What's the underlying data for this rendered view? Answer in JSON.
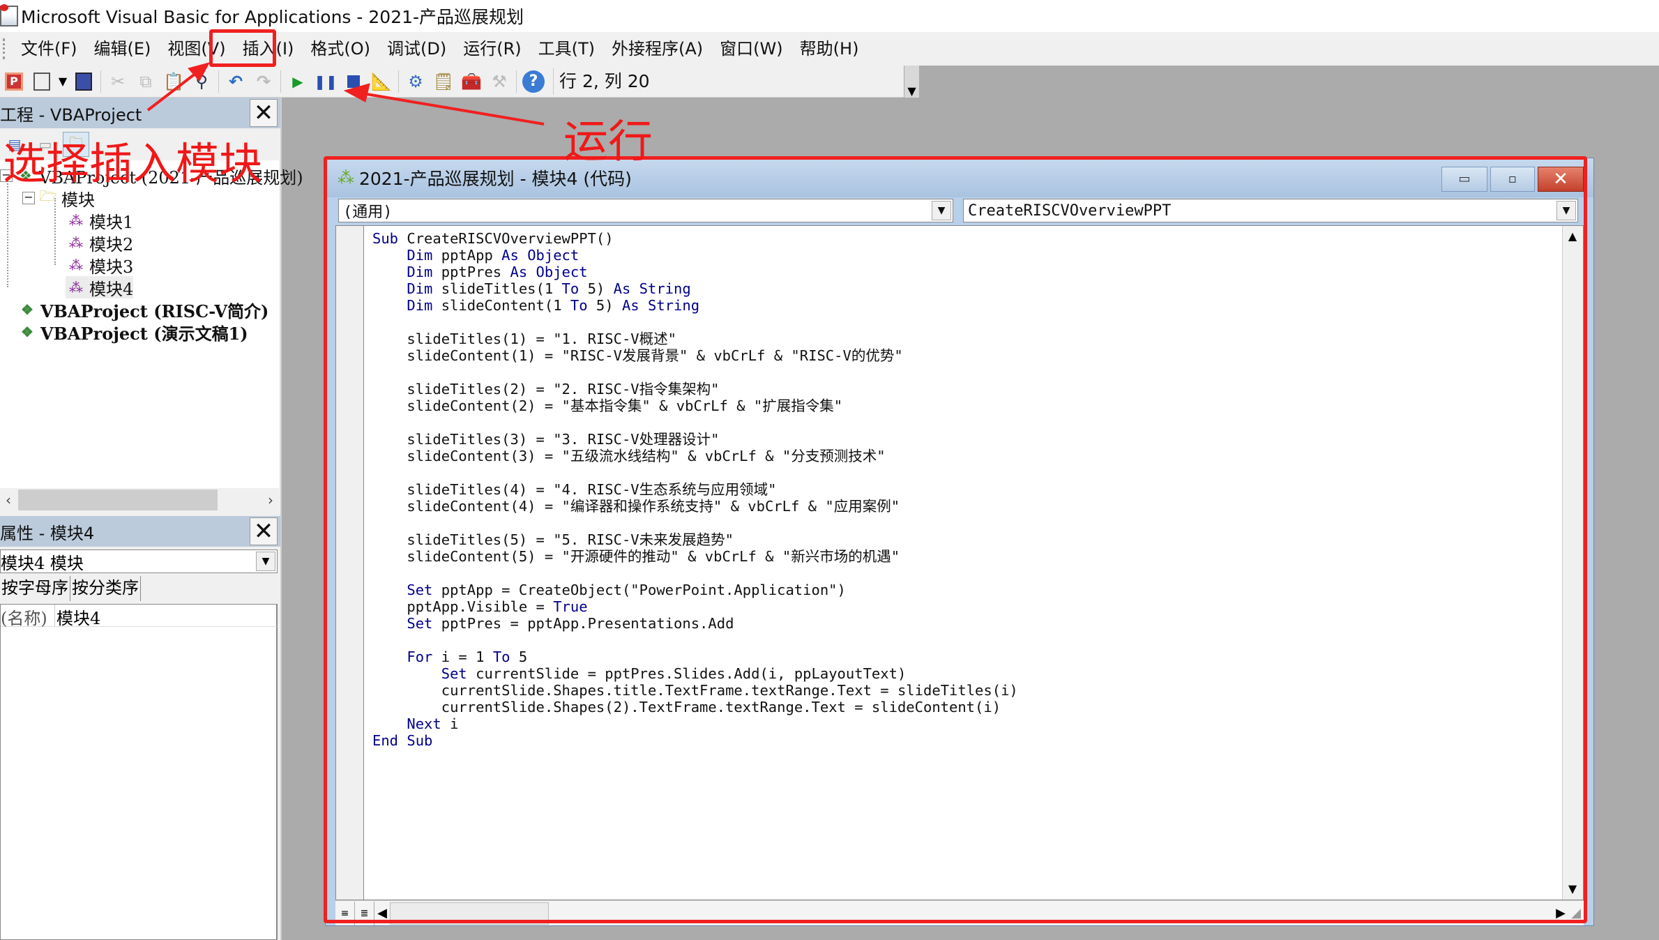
{
  "window": {
    "title": "Microsoft Visual Basic for Applications - 2021-产品巡展规划"
  },
  "menu": {
    "items": [
      "文件(F)",
      "编辑(E)",
      "视图(V)",
      "插入(I)",
      "格式(O)",
      "调试(D)",
      "运行(R)",
      "工具(T)",
      "外接程序(A)",
      "窗口(W)",
      "帮助(H)"
    ]
  },
  "toolbar": {
    "cursor_position": "行 2, 列 20",
    "buttons": [
      "view-powerpoint",
      "insert-module",
      "save",
      "cut",
      "copy",
      "paste",
      "find",
      "undo",
      "redo",
      "run",
      "break",
      "reset",
      "design-mode",
      "project-explorer",
      "properties-window",
      "object-browser",
      "toolbox",
      "help"
    ]
  },
  "project_pane": {
    "title": "工程 - VBAProject",
    "tree": {
      "root": "VBAProject (2021-产品巡展规划)",
      "folder": "模块",
      "modules": [
        "模块1",
        "模块2",
        "模块3",
        "模块4"
      ],
      "other_projects": [
        "VBAProject (RISC-V简介)",
        "VBAProject (演示文稿1)"
      ]
    }
  },
  "properties_pane": {
    "title": "属性 - 模块4",
    "object_select": "模块4 模块",
    "tabs": [
      "按字母序",
      "按分类序"
    ],
    "rows": [
      {
        "name": "(名称)",
        "value": "模块4"
      }
    ]
  },
  "code_window": {
    "title": "2021-产品巡展规划 - 模块4 (代码)",
    "object_combo": "(通用)",
    "procedure_combo": "CreateRISCVOverviewPPT",
    "code_lines": [
      "Sub CreateRISCVOverviewPPT()",
      "    Dim pptApp As Object",
      "    Dim pptPres As Object",
      "    Dim slideTitles(1 To 5) As String",
      "    Dim slideContent(1 To 5) As String",
      "",
      "    slideTitles(1) = \"1. RISC-V概述\"",
      "    slideContent(1) = \"RISC-V发展背景\" & vbCrLf & \"RISC-V的优势\"",
      "",
      "    slideTitles(2) = \"2. RISC-V指令集架构\"",
      "    slideContent(2) = \"基本指令集\" & vbCrLf & \"扩展指令集\"",
      "",
      "    slideTitles(3) = \"3. RISC-V处理器设计\"",
      "    slideContent(3) = \"五级流水线结构\" & vbCrLf & \"分支预测技术\"",
      "",
      "    slideTitles(4) = \"4. RISC-V生态系统与应用领域\"",
      "    slideContent(4) = \"编译器和操作系统支持\" & vbCrLf & \"应用案例\"",
      "",
      "    slideTitles(5) = \"5. RISC-V未来发展趋势\"",
      "    slideContent(5) = \"开源硬件的推动\" & vbCrLf & \"新兴市场的机遇\"",
      "",
      "    Set pptApp = CreateObject(\"PowerPoint.Application\")",
      "    pptApp.Visible = True",
      "    Set pptPres = pptApp.Presentations.Add",
      "",
      "    For i = 1 To 5",
      "        Set currentSlide = pptPres.Slides.Add(i, ppLayoutText)",
      "        currentSlide.Shapes.title.TextFrame.textRange.Text = slideTitles(i)",
      "        currentSlide.Shapes(2).TextFrame.textRange.Text = slideContent(i)",
      "    Next i",
      "End Sub"
    ],
    "keywords": [
      "Sub",
      "Dim",
      "As",
      "Object",
      "String",
      "To",
      "Set",
      "True",
      "For",
      "Next",
      "End"
    ]
  },
  "annotations": {
    "insert_label": "选择插入模块",
    "run_label": "运行",
    "color": "#f02020"
  },
  "colors": {
    "keyword": "#00008b",
    "pane_header": "#bccbdc",
    "mdi_background": "#ababab"
  }
}
